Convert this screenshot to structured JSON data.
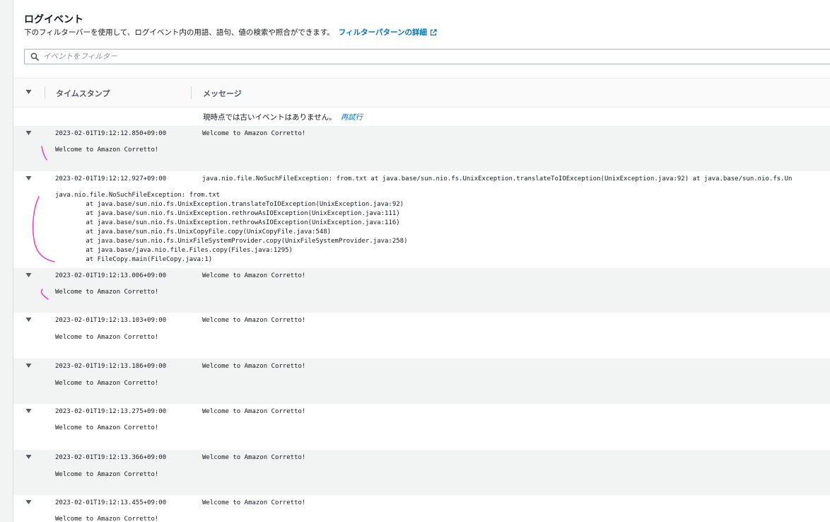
{
  "header": {
    "title": "ログイベント",
    "description": "下のフィルターバーを使用して、ログイベント内の用語、語句、値の検索や照合ができます。",
    "link_label": "フィルターパターンの詳細",
    "link_icon": "external-link-icon"
  },
  "search": {
    "placeholder": "イベントをフィルター",
    "value": "",
    "icon": "search-icon"
  },
  "table": {
    "columns": [
      "タイムスタンプ",
      "メッセージ"
    ],
    "no_older_text": "現時点では古いイベントはありません。",
    "retry_label": "再試行",
    "rows": [
      {
        "timestamp": "2023-02-01T19:12:12.850+09:00",
        "message": "Welcome to Amazon Corretto!",
        "detail": "Welcome to Amazon Corretto!"
      },
      {
        "timestamp": "2023-02-01T19:12:12.927+09:00",
        "message": "java.nio.file.NoSuchFileException: from.txt at java.base/sun.nio.fs.UnixException.translateToIOException(UnixException.java:92) at java.base/sun.nio.fs.Un",
        "detail": "java.nio.file.NoSuchFileException: from.txt\n        at java.base/sun.nio.fs.UnixException.translateToIOException(UnixException.java:92)\n        at java.base/sun.nio.fs.UnixException.rethrowAsIOException(UnixException.java:111)\n        at java.base/sun.nio.fs.UnixException.rethrowAsIOException(UnixException.java:116)\n        at java.base/sun.nio.fs.UnixCopyFile.copy(UnixCopyFile.java:548)\n        at java.base/sun.nio.fs.UnixFileSystemProvider.copy(UnixFileSystemProvider.java:258)\n        at java.base/java.nio.file.Files.copy(Files.java:1295)\n        at FileCopy.main(FileCopy.java:1)"
      },
      {
        "timestamp": "2023-02-01T19:12:13.006+09:00",
        "message": "Welcome to Amazon Corretto!",
        "detail": "Welcome to Amazon Corretto!"
      },
      {
        "timestamp": "2023-02-01T19:12:13.103+09:00",
        "message": "Welcome to Amazon Corretto!",
        "detail": "Welcome to Amazon Corretto!"
      },
      {
        "timestamp": "2023-02-01T19:12:13.186+09:00",
        "message": "Welcome to Amazon Corretto!",
        "detail": "Welcome to Amazon Corretto!"
      },
      {
        "timestamp": "2023-02-01T19:12:13.275+09:00",
        "message": "Welcome to Amazon Corretto!",
        "detail": "Welcome to Amazon Corretto!"
      },
      {
        "timestamp": "2023-02-01T19:12:13.366+09:00",
        "message": "Welcome to Amazon Corretto!",
        "detail": "Welcome to Amazon Corretto!"
      },
      {
        "timestamp": "2023-02-01T19:12:13.455+09:00",
        "message": "Welcome to Amazon Corretto!",
        "detail": "Welcome to Amazon Corretto!"
      }
    ]
  },
  "colors": {
    "link": "#0073bb",
    "annotation": "#e83cd7",
    "row_shade": "#f2f3f3"
  }
}
